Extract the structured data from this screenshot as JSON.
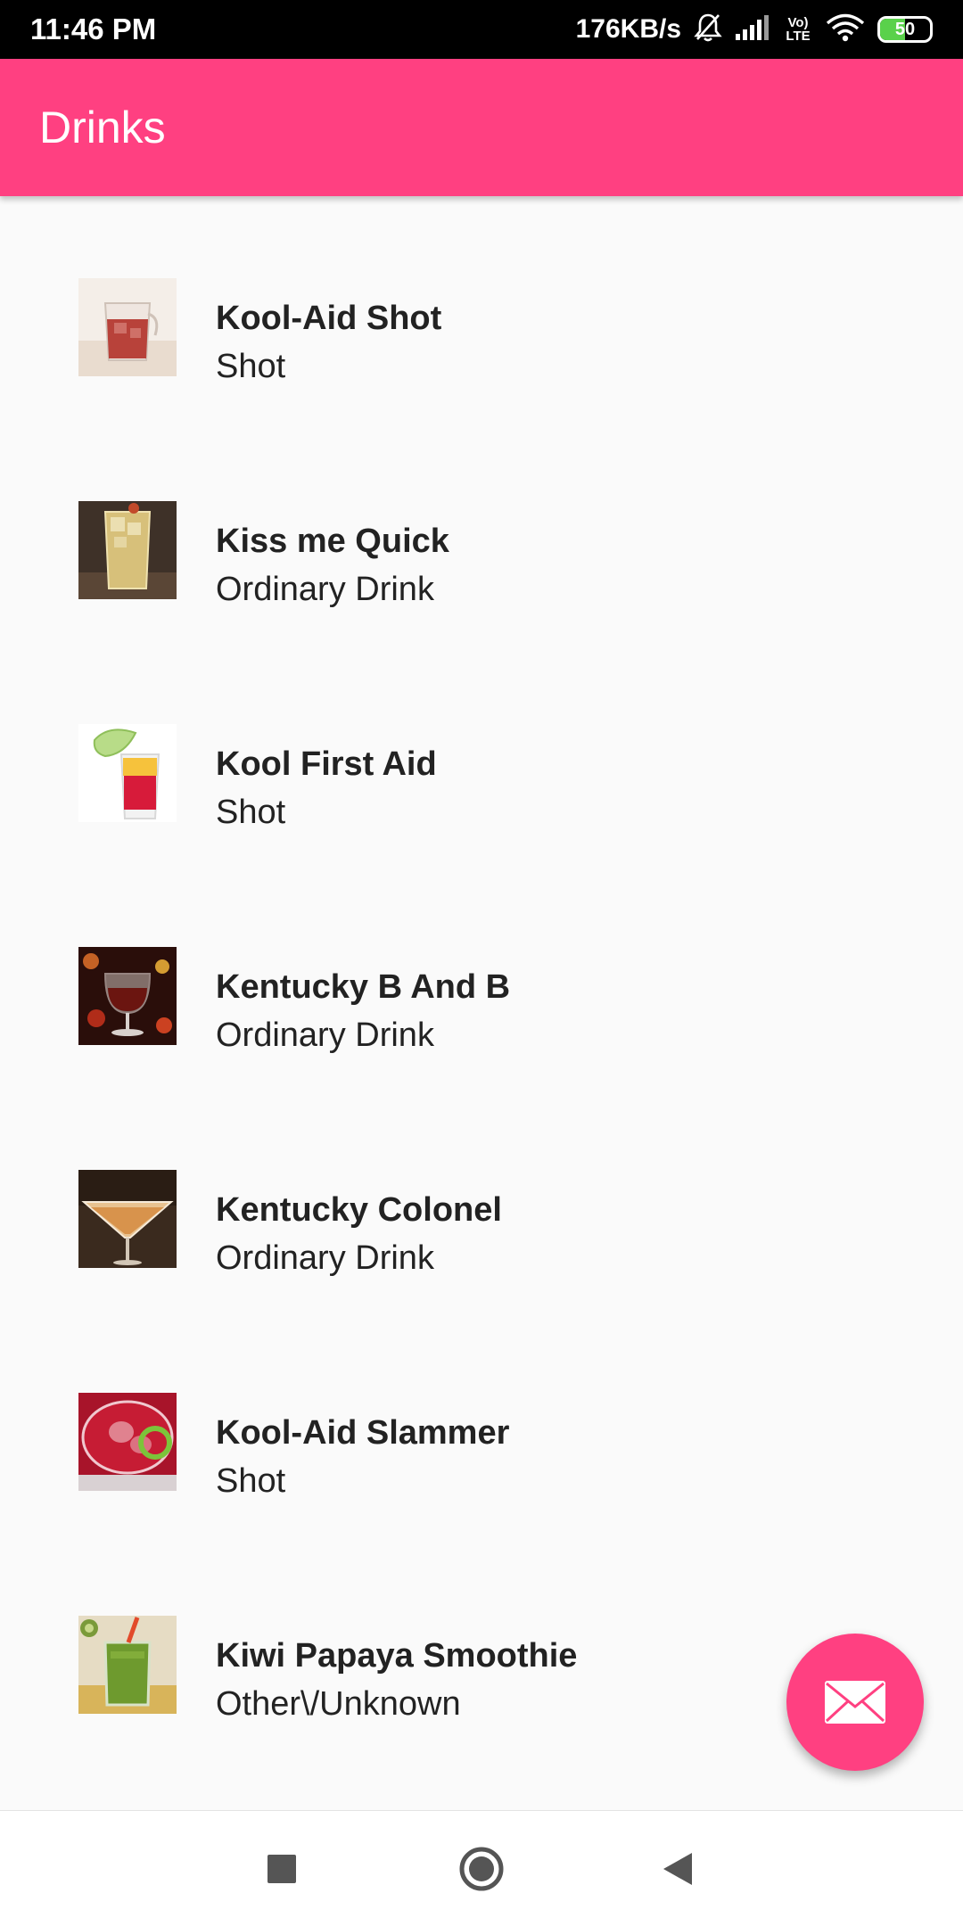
{
  "status_bar": {
    "time": "11:46 PM",
    "network_speed": "176KB/s",
    "volte_label_top": "Vo)",
    "volte_label_bottom": "LTE",
    "battery_level": "50",
    "battery_fraction": 0.5,
    "icons": [
      "bell-muted-icon",
      "signal-icon",
      "volte-icon",
      "wifi-icon",
      "battery-icon"
    ]
  },
  "app_bar": {
    "title": "Drinks"
  },
  "drinks": [
    {
      "name": "Kool-Aid Shot",
      "category": "Shot",
      "thumb": "red-iced-cocktail-glass"
    },
    {
      "name": "Kiss me Quick",
      "category": "Ordinary Drink",
      "thumb": "amber-iced-highball"
    },
    {
      "name": "Kool First Aid",
      "category": "Shot",
      "thumb": "layered-shot-with-lime"
    },
    {
      "name": "Kentucky B And B",
      "category": "Ordinary Drink",
      "thumb": "brandy-snifter-bokeh"
    },
    {
      "name": "Kentucky Colonel",
      "category": "Ordinary Drink",
      "thumb": "martini-glass-amber"
    },
    {
      "name": "Kool-Aid Slammer",
      "category": "Shot",
      "thumb": "red-drink-with-lime"
    },
    {
      "name": "Kiwi Papaya Smoothie",
      "category": "Other\\/Unknown",
      "thumb": "green-smoothie-jar"
    }
  ],
  "fab": {
    "icon": "envelope-icon",
    "color": "#ff4081"
  },
  "nav_bar": {
    "buttons": [
      "recents-square-icon",
      "home-circle-icon",
      "back-triangle-icon"
    ]
  },
  "colors": {
    "accent": "#ff4081",
    "status_bar_bg": "#000000",
    "list_bg": "#fafafa",
    "text": "#222222"
  }
}
